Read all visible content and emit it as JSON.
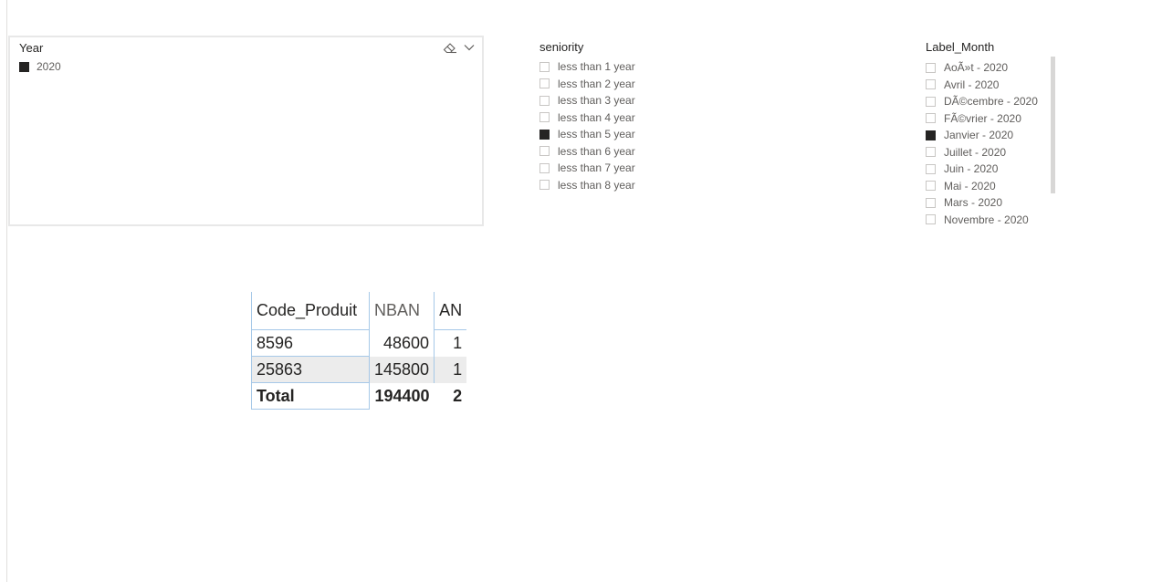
{
  "year_slicer": {
    "title": "Year",
    "items": [
      {
        "label": "2020",
        "checked": true
      }
    ],
    "icons": [
      "eraser-icon",
      "chevron-down-icon"
    ]
  },
  "seniority_slicer": {
    "title": "seniority",
    "items": [
      {
        "label": "less than 1 year",
        "checked": false
      },
      {
        "label": "less than 2 year",
        "checked": false
      },
      {
        "label": "less than 3 year",
        "checked": false
      },
      {
        "label": "less than 4 year",
        "checked": false
      },
      {
        "label": "less than 5 year",
        "checked": true
      },
      {
        "label": "less than 6 year",
        "checked": false
      },
      {
        "label": "less than 7 year",
        "checked": false
      },
      {
        "label": "less than 8 year",
        "checked": false
      }
    ]
  },
  "month_slicer": {
    "title": "Label_Month",
    "items": [
      {
        "label": "AoÃ»t - 2020",
        "checked": false
      },
      {
        "label": "Avril - 2020",
        "checked": false
      },
      {
        "label": "DÃ©cembre - 2020",
        "checked": false
      },
      {
        "label": "FÃ©vrier - 2020",
        "checked": false
      },
      {
        "label": "Janvier - 2020",
        "checked": true
      },
      {
        "label": "Juillet - 2020",
        "checked": false
      },
      {
        "label": "Juin - 2020",
        "checked": false
      },
      {
        "label": "Mai - 2020",
        "checked": false
      },
      {
        "label": "Mars - 2020",
        "checked": false
      },
      {
        "label": "Novembre - 2020",
        "checked": false
      }
    ]
  },
  "table": {
    "headers": [
      "Code_Produit",
      "NBAN",
      "AN"
    ],
    "rows": [
      [
        "8596",
        "48600",
        "1"
      ],
      [
        "25863",
        "145800",
        "1"
      ]
    ],
    "total": [
      "Total",
      "194400",
      "2"
    ]
  },
  "colors": {
    "checked": "#252423",
    "grid_line": "#a6c8e8",
    "row_alt": "#ececec"
  }
}
